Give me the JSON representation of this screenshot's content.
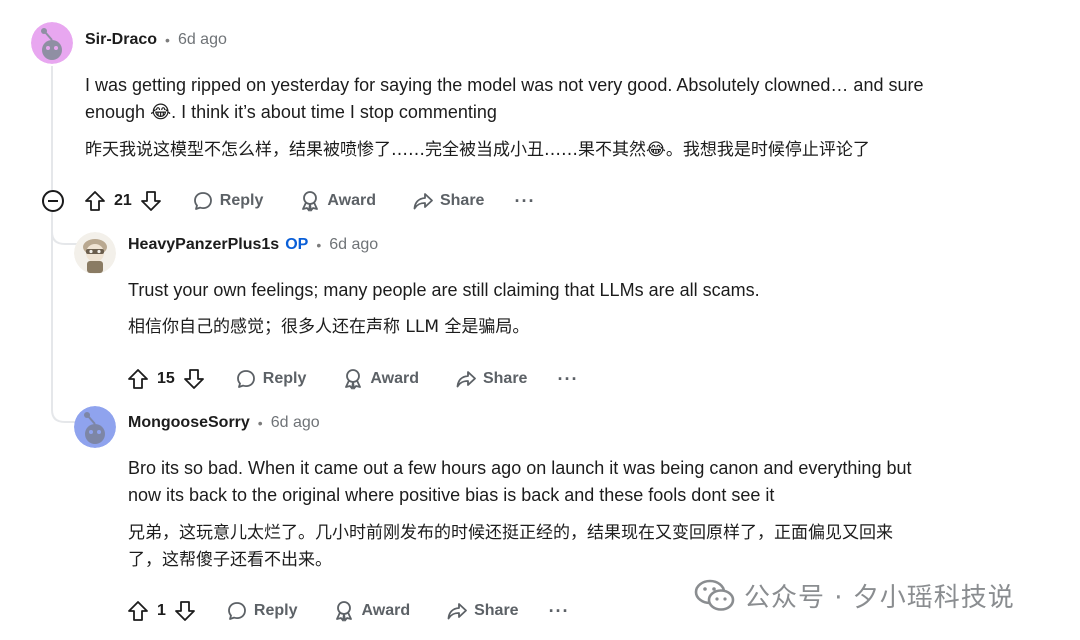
{
  "comments": [
    {
      "username": "Sir-Draco",
      "time": "6d ago",
      "body_en_1": "I was getting ripped on yesterday for saying the model was not very good. Absolutely clowned… and sure",
      "body_en_2": "enough 😂. I think it’s about time I stop commenting",
      "body_zh": "昨天我说这模型不怎么样，结果被喷惨了……完全被当成小丑……果不其然😂。我想我是时候停止评论了",
      "votes": "21",
      "reply_label": "Reply",
      "award_label": "Award",
      "share_label": "Share",
      "more_label": "···"
    },
    {
      "username": "HeavyPanzerPlus1s",
      "op_badge": "OP",
      "time": "6d ago",
      "body_en_1": "Trust your own feelings; many people are still claiming that LLMs are all scams.",
      "body_zh_1": "相信你自己的感觉；很多人还在声称 LLM 全是骗局。",
      "votes": "15",
      "reply_label": "Reply",
      "award_label": "Award",
      "share_label": "Share",
      "more_label": "···"
    },
    {
      "username": "MongooseSorry",
      "time": "6d ago",
      "body_en_1": "Bro its so bad. When it came out a few hours ago on launch it was being canon and everything but",
      "body_en_2": "now its back to the original where positive bias is back and these fools dont see it",
      "body_zh_1": "兄弟，这玩意儿太烂了。几小时前刚发布的时候还挺正经的，结果现在又变回原样了，正面偏见又回来",
      "body_zh_2": "了，这帮傻子还看不出来。",
      "votes": "1",
      "reply_label": "Reply",
      "award_label": "Award",
      "share_label": "Share",
      "more_label": "···"
    }
  ],
  "separator": "•",
  "watermark": {
    "text": "公众号 · 夕小瑶科技说",
    "icon": "wechat-icon"
  },
  "colors": {
    "avatar_pink": "#e8a7f0",
    "avatar_blue": "#8fa3ee",
    "op_blue": "#0a5fd8",
    "muted": "#5c6166"
  }
}
